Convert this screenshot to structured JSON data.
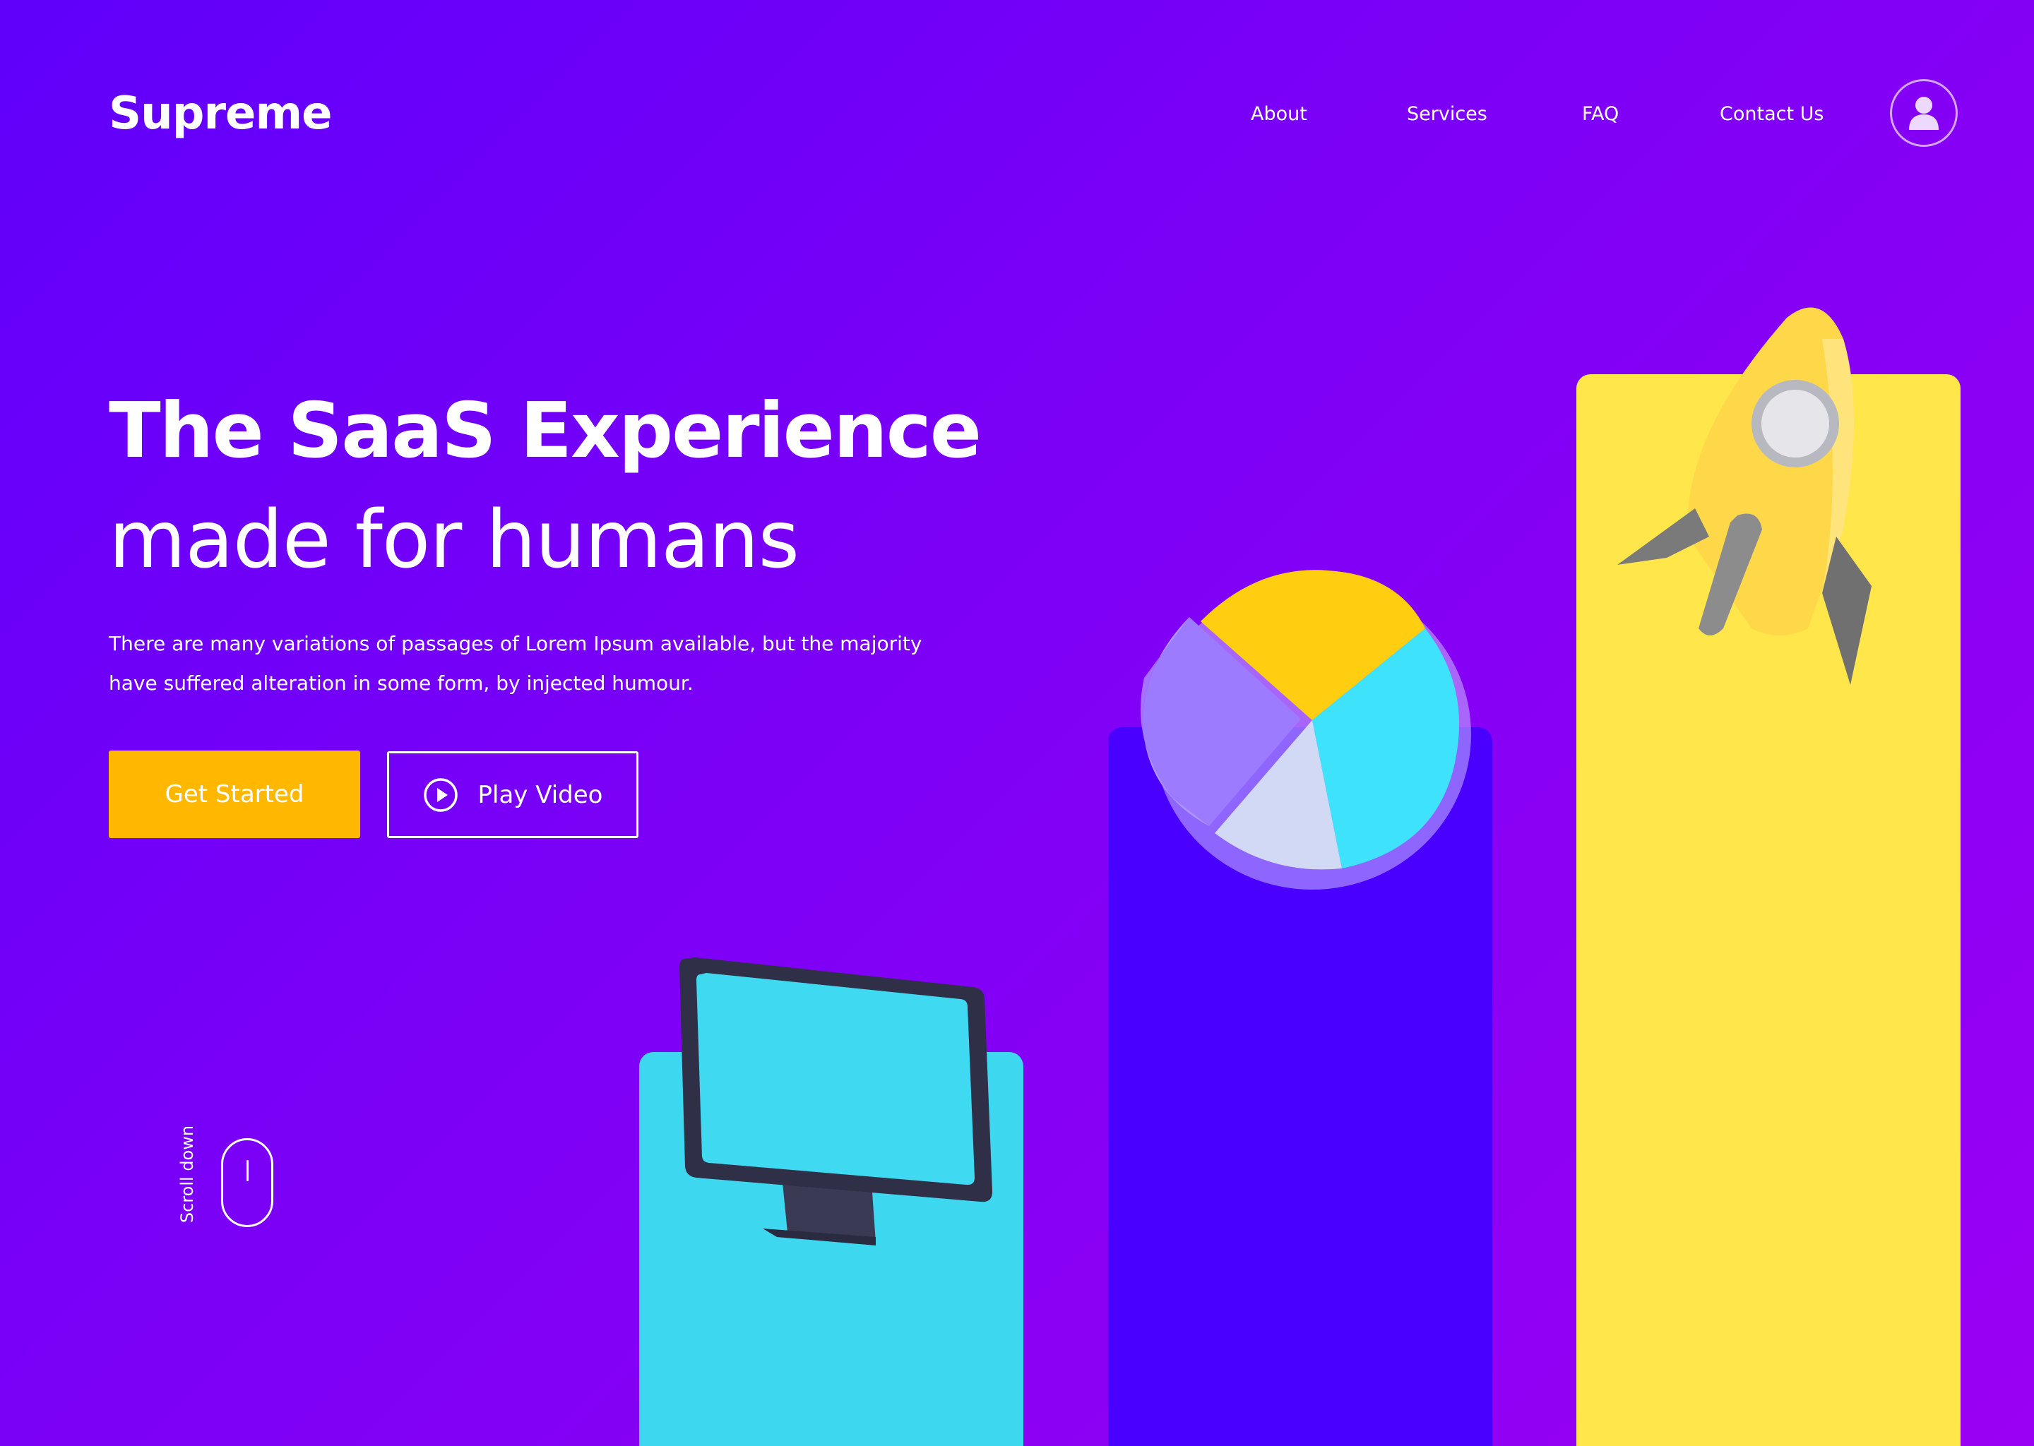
{
  "header": {
    "logo": "Supreme",
    "nav": [
      "About",
      "Services",
      "FAQ",
      "Contact Us"
    ],
    "avatar_icon": "user-icon"
  },
  "hero": {
    "title": "The SaaS Experience",
    "subtitle": "made for humans",
    "description": "There are many variations of passages of Lorem Ipsum available, but the majority have suffered alteration in some form, by injected humour.",
    "primary_button": "Get Started",
    "secondary_button": "Play Video",
    "secondary_icon": "play-circle-icon"
  },
  "scroll": {
    "label": "Scroll down",
    "icon": "mouse-icon"
  },
  "illustrations": {
    "monitor_icon": "monitor-icon",
    "pie_chart_icon": "pie-chart-icon",
    "rocket_icon": "rocket-icon"
  },
  "colors": {
    "background_start": "#5f00fb",
    "background_end": "#9a00f3",
    "accent": "#ffb700",
    "cyan": "#3dd7f0",
    "indigo": "#4a00ff",
    "yellow": "#ffe64b"
  }
}
